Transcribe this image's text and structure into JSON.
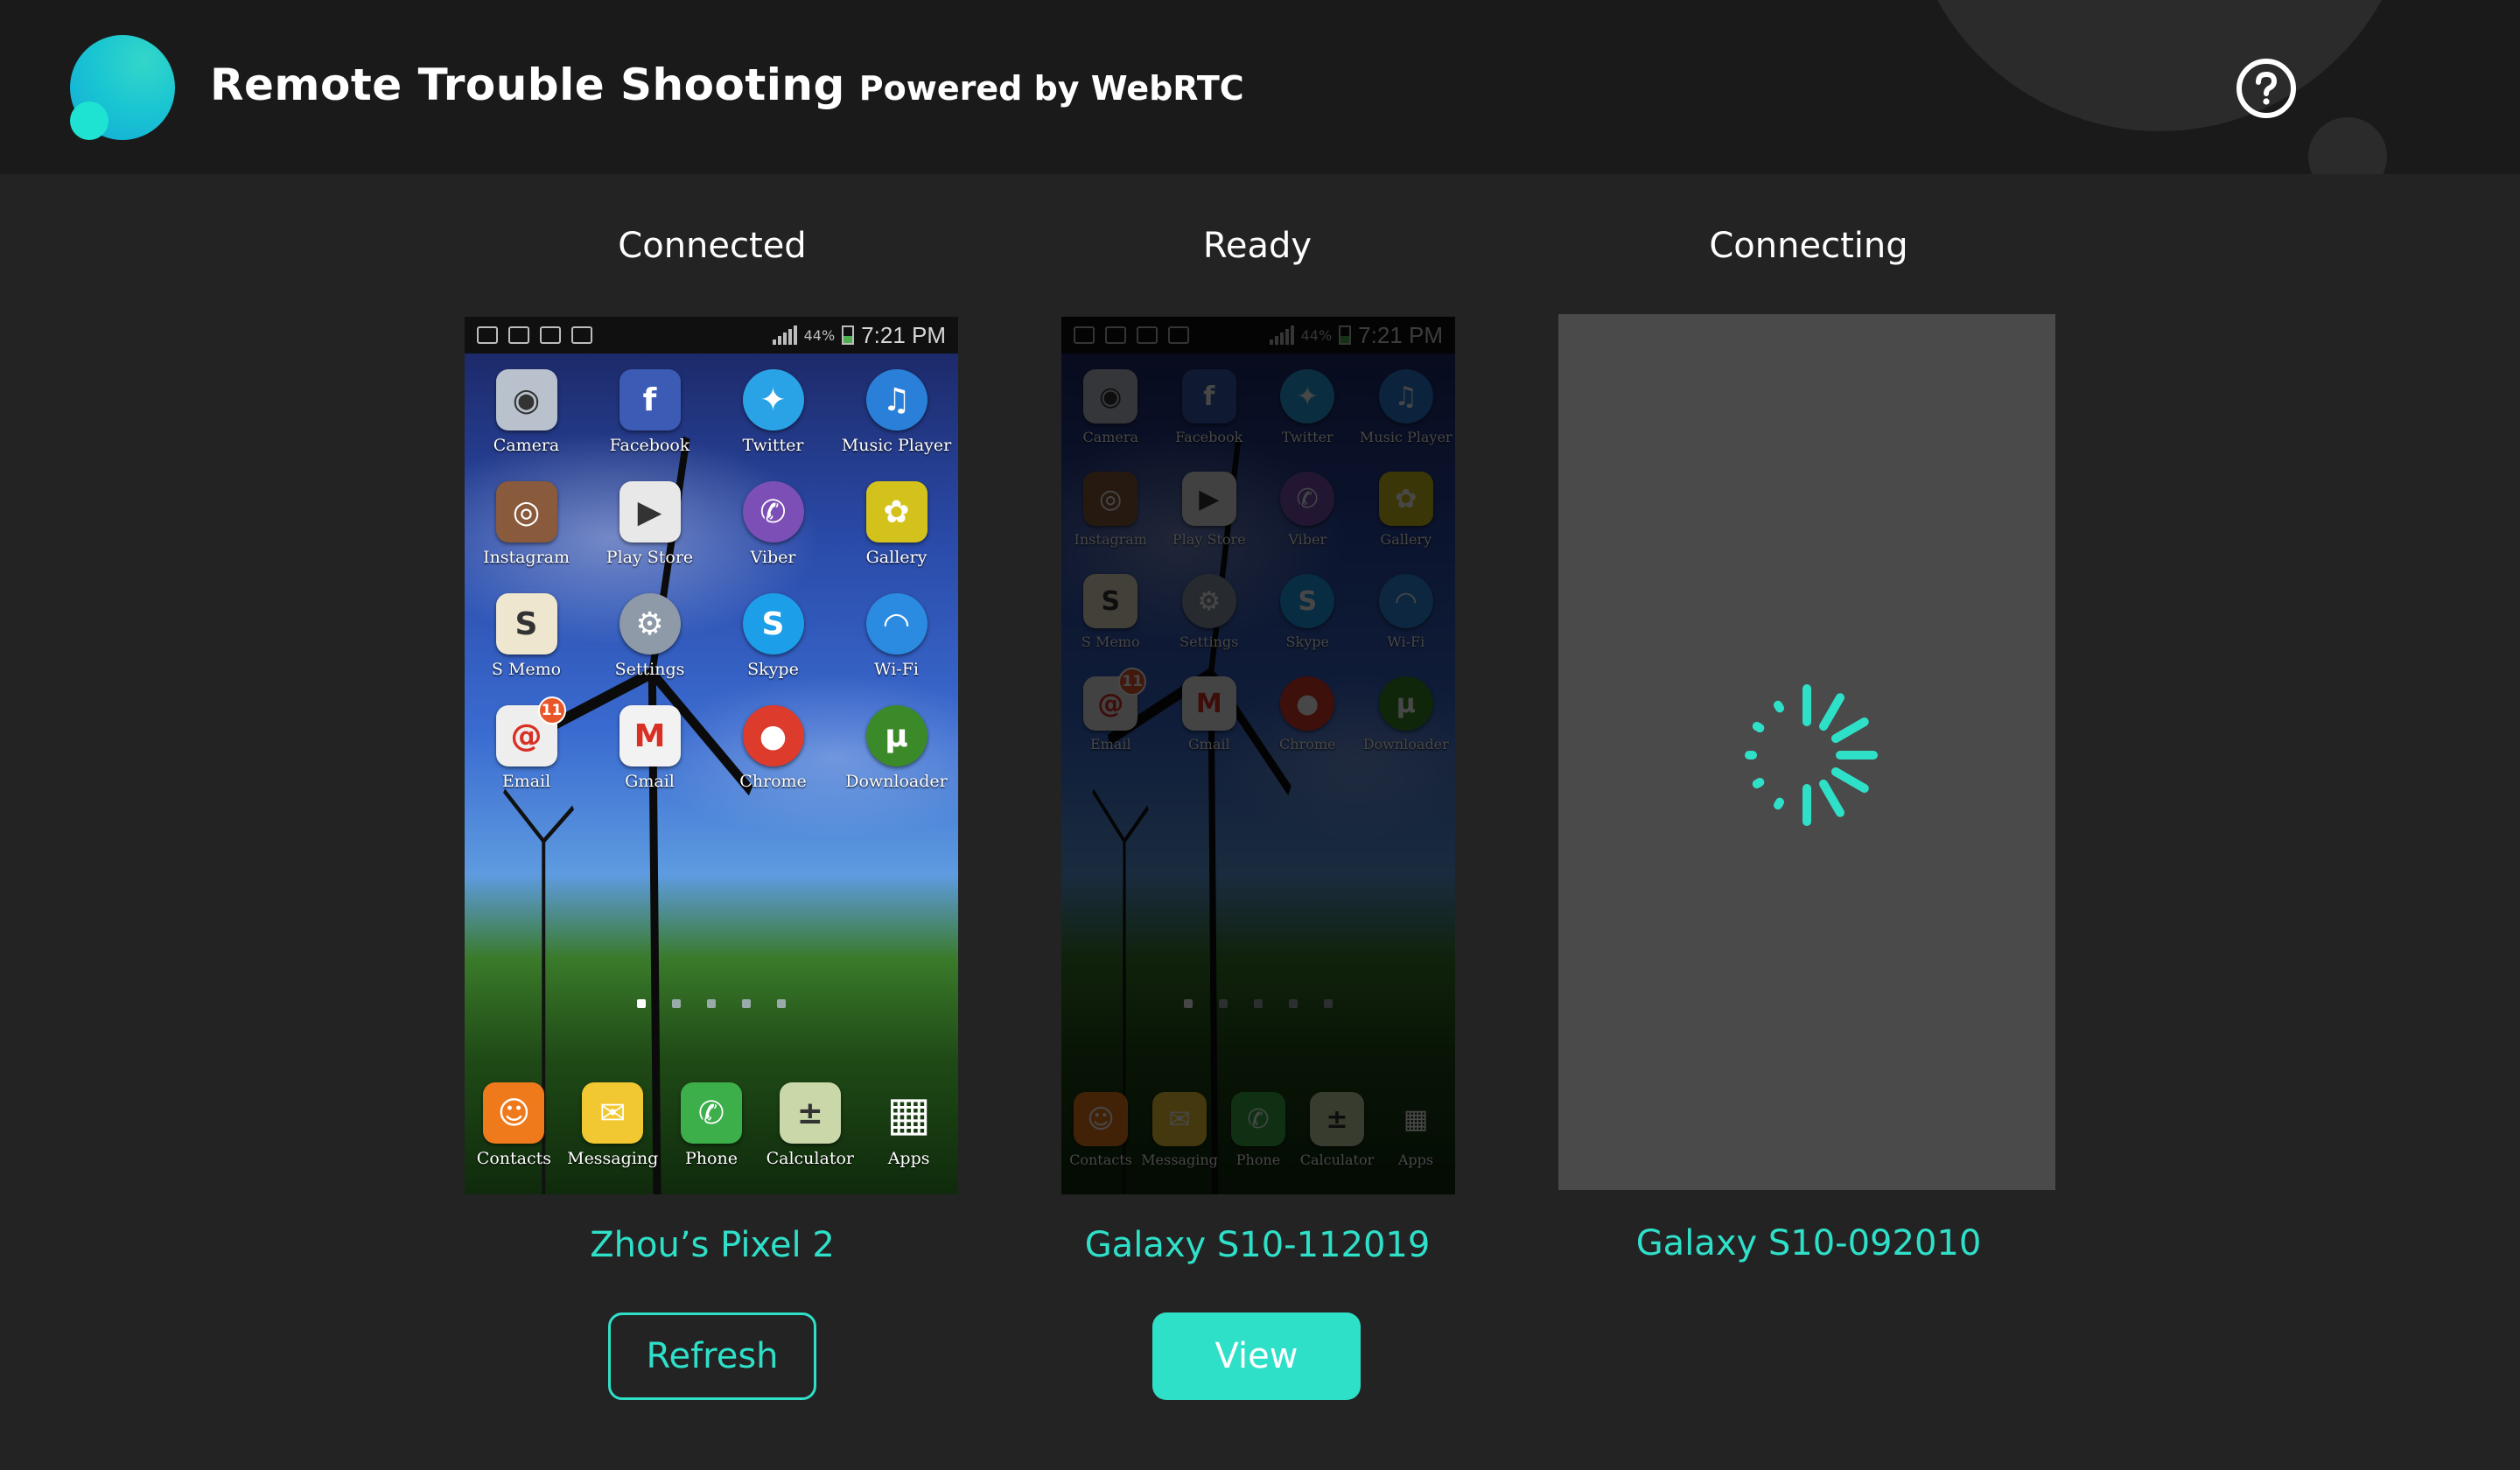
{
  "header": {
    "title": "Remote Trouble Shooting",
    "subtitle": "Powered by WebRTC",
    "help_icon": "question-circle-icon"
  },
  "colors": {
    "accent": "#2fe0c9",
    "background": "#232323",
    "header_bg": "#1a1a1a",
    "placeholder_bg": "#4a4a4a"
  },
  "devices": [
    {
      "status": "Connected",
      "name": "Zhou’s Pixel 2",
      "action_label": "Refresh",
      "phone": {
        "time": "7:21 PM",
        "battery": "44%",
        "apps": [
          "Camera",
          "Facebook",
          "Twitter",
          "Music Player",
          "Instagram",
          "Play Store",
          "Viber",
          "Gallery",
          "S Memo",
          "Settings",
          "Skype",
          "Wi-Fi",
          "Email",
          "Gmail",
          "Chrome",
          "Downloader"
        ],
        "email_badge": "11",
        "dock": [
          "Contacts",
          "Messaging",
          "Phone",
          "Calculator",
          "Apps"
        ]
      }
    },
    {
      "status": "Ready",
      "name": "Galaxy S10-112019",
      "action_label": "View",
      "phone": {
        "time": "7:21 PM",
        "battery": "44%",
        "apps": [
          "Camera",
          "Facebook",
          "Twitter",
          "Music Player",
          "Instagram",
          "Play Store",
          "Viber",
          "Gallery",
          "S Memo",
          "Settings",
          "Skype",
          "Wi-Fi",
          "Email",
          "Gmail",
          "Chrome",
          "Downloader"
        ],
        "email_badge": "11",
        "dock": [
          "Contacts",
          "Messaging",
          "Phone",
          "Calculator",
          "Apps"
        ]
      }
    },
    {
      "status": "Connecting",
      "name": "Galaxy S10-092010",
      "loading_icon": "spinner-icon"
    }
  ]
}
